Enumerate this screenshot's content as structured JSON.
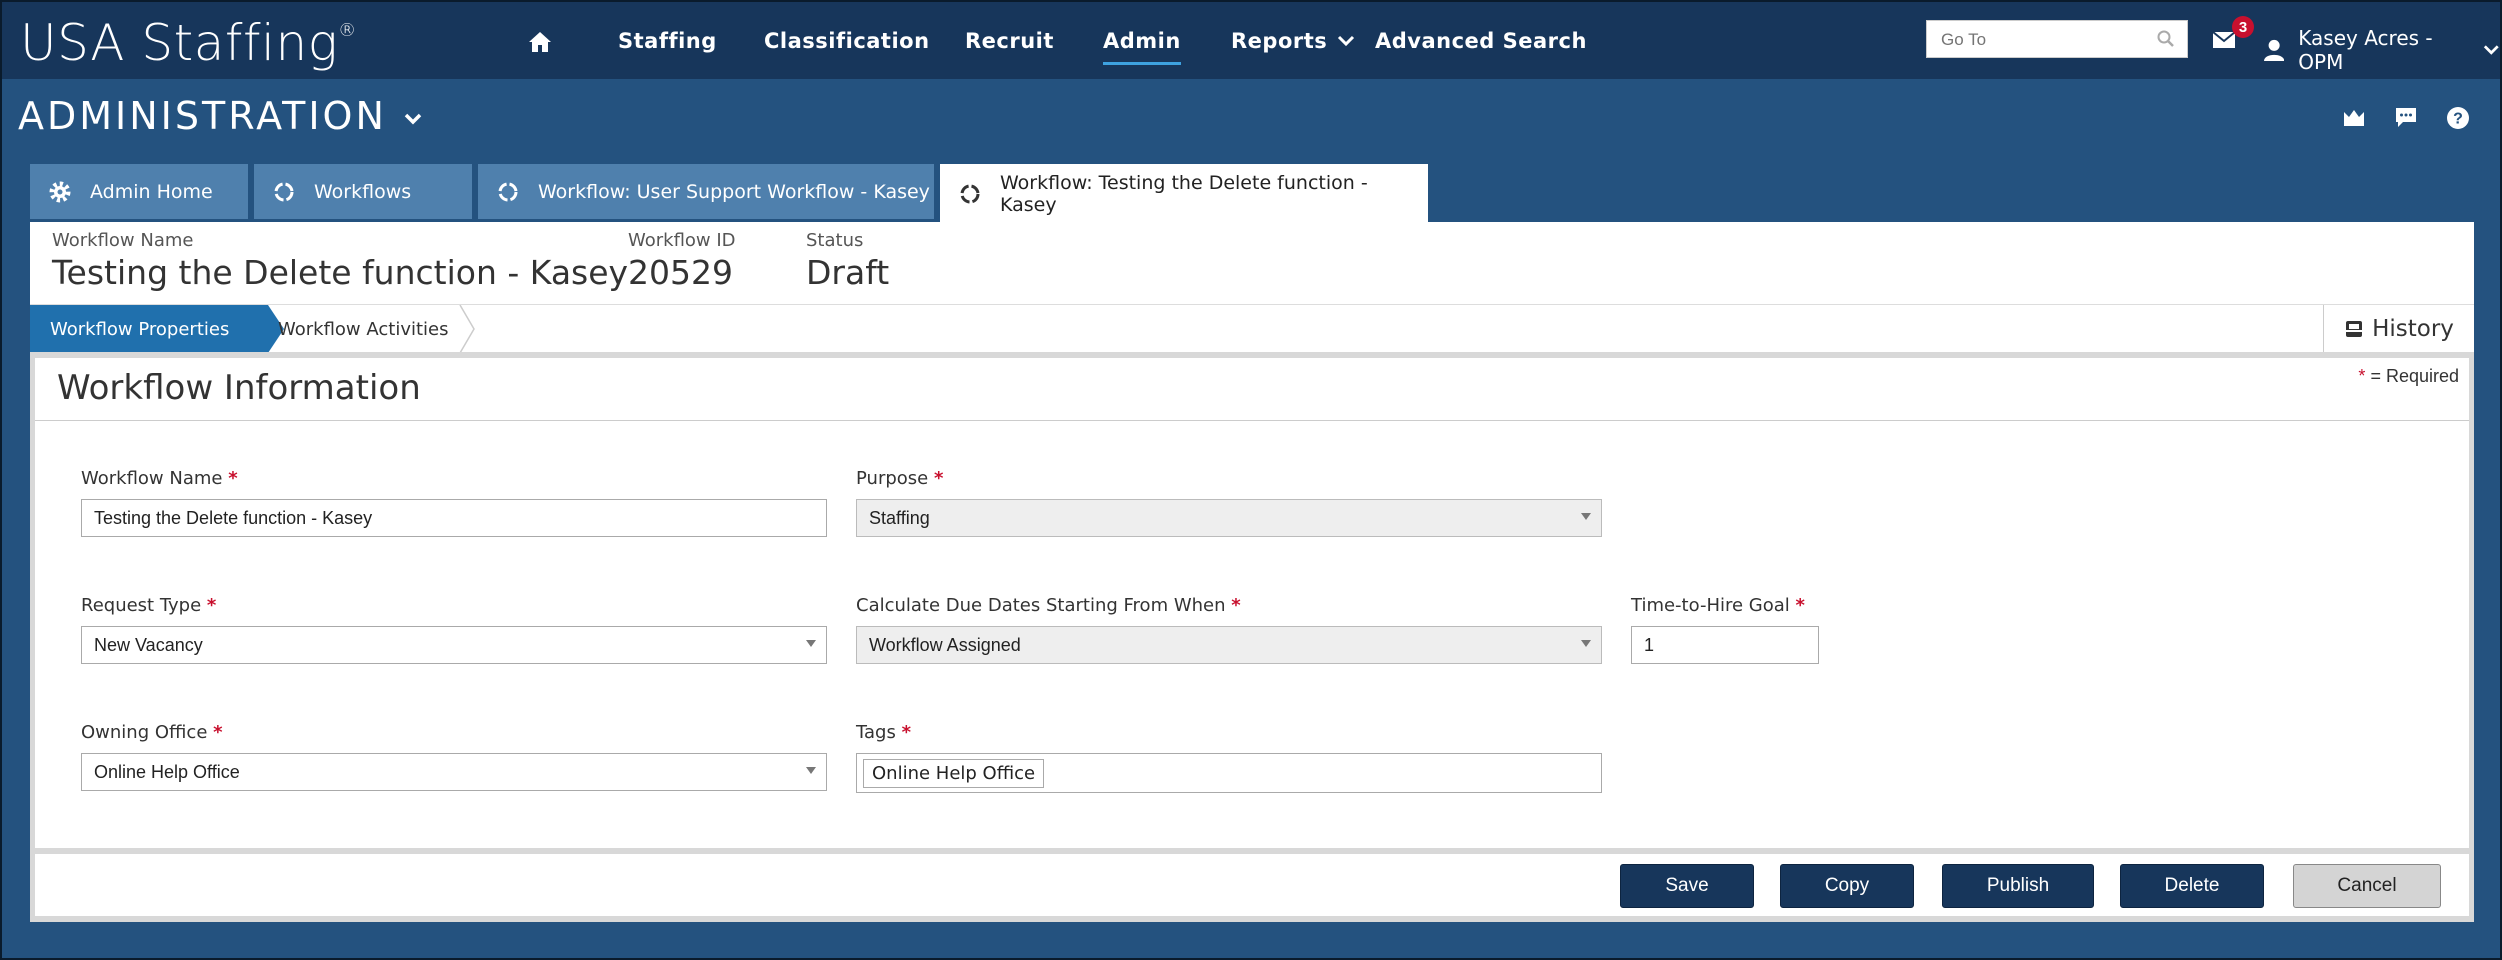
{
  "app": {
    "logo_text": "USA Staffing",
    "logo_mark": "®"
  },
  "nav": {
    "items": [
      "Staffing",
      "Classification",
      "Recruit",
      "Admin",
      "Reports",
      "Advanced Search"
    ],
    "active": "Admin"
  },
  "goto": {
    "placeholder": "Go To",
    "value": ""
  },
  "notifications": {
    "count": "3"
  },
  "user": {
    "name": "Kasey Acres - OPM"
  },
  "section": {
    "title": "ADMINISTRATION"
  },
  "tabs": [
    {
      "label": "Admin Home",
      "icon": "gear-icon"
    },
    {
      "label": "Workflows",
      "icon": "cycle-icon"
    },
    {
      "label": "Workflow: User Support Workflow - Kasey",
      "icon": "cycle-icon"
    },
    {
      "label": "Workflow: Testing the Delete function - Kasey",
      "icon": "cycle-icon",
      "active": true
    }
  ],
  "summary": {
    "name_label": "Workflow Name",
    "name_value": "Testing the Delete function - Kasey",
    "id_label": "Workflow ID",
    "id_value": "20529",
    "status_label": "Status",
    "status_value": "Draft"
  },
  "steps": {
    "properties": "Workflow Properties",
    "activities": "Workflow Activities",
    "history": "History"
  },
  "form": {
    "title": "Workflow Information",
    "required_note_star": "*",
    "required_note": "= Required",
    "workflow_name": {
      "label": "Workflow Name",
      "value": "Testing the Delete function - Kasey"
    },
    "purpose": {
      "label": "Purpose",
      "value": "Staffing"
    },
    "request_type": {
      "label": "Request Type",
      "value": "New Vacancy"
    },
    "calc_due": {
      "label": "Calculate Due Dates Starting From When",
      "value": "Workflow Assigned"
    },
    "time_to_hire": {
      "label": "Time-to-Hire Goal",
      "value": "1"
    },
    "owning_office": {
      "label": "Owning Office",
      "value": "Online Help Office"
    },
    "tags": {
      "label": "Tags",
      "value": "Online Help Office"
    },
    "required_star": "*"
  },
  "buttons": {
    "save": "Save",
    "copy": "Copy",
    "publish": "Publish",
    "delete": "Delete",
    "cancel": "Cancel"
  },
  "colors": {
    "topbar": "#17365b",
    "background": "#24527f",
    "tab": "#4f80ad",
    "accent": "#2070ad",
    "required": "#c8102e"
  }
}
